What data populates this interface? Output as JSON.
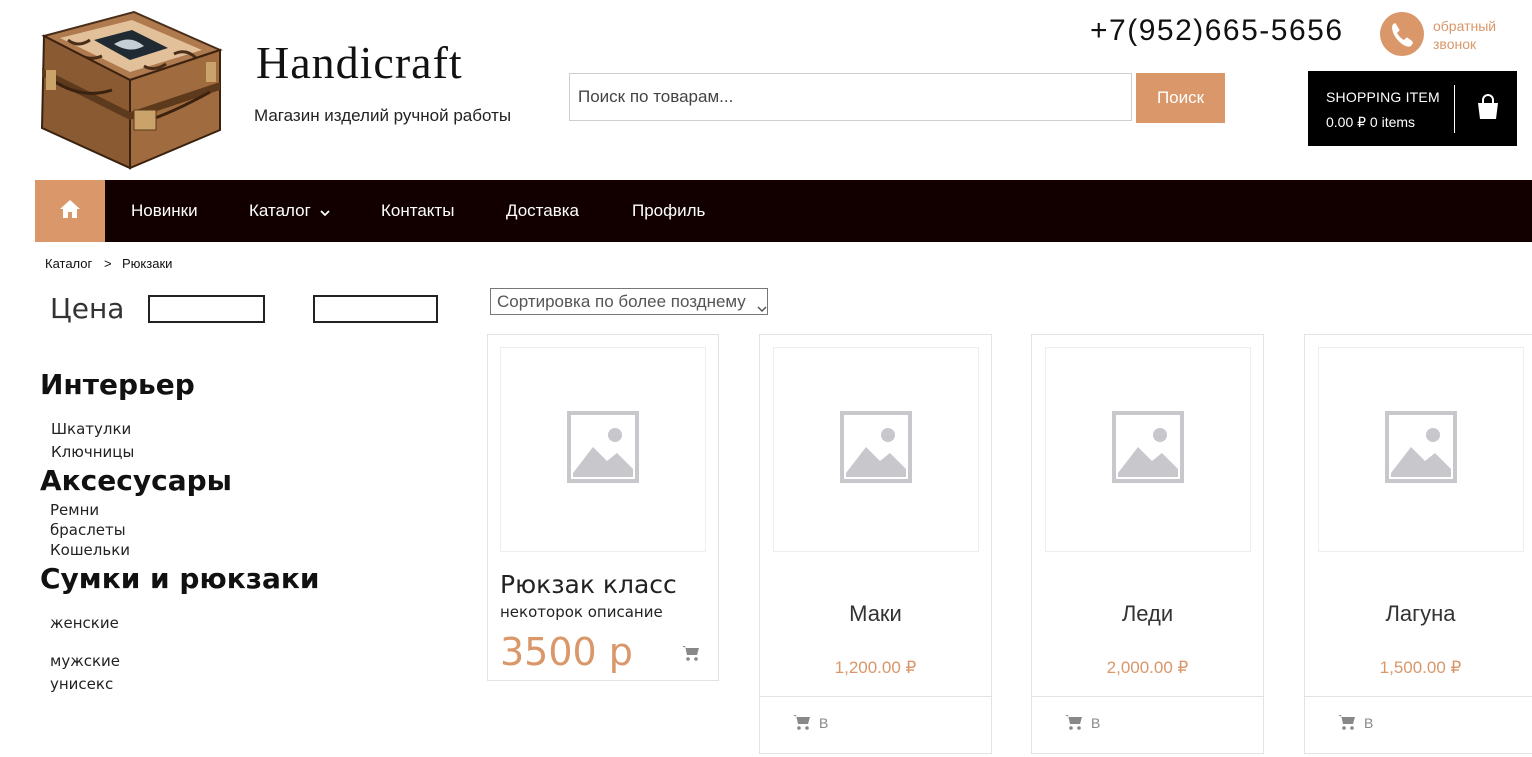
{
  "header": {
    "site_title": "Handicraft",
    "tagline": "Магазин изделий ручной работы",
    "phone": "+7(952)665-5656",
    "callback_line1": "обратный",
    "callback_line2": "звонок"
  },
  "search": {
    "placeholder": "Поиск по товарам...",
    "button_label": "Поиск"
  },
  "cart": {
    "title": "SHOPPING ITEM",
    "summary": "0.00 ₽ 0 items"
  },
  "nav": {
    "items": [
      "Новинки",
      "Каталог",
      "Контакты",
      "Доставка",
      "Профиль"
    ]
  },
  "breadcrumb": {
    "items": [
      "Каталог",
      ">",
      "Рюкзаки"
    ]
  },
  "filter": {
    "price_label": "Цена"
  },
  "categories": [
    {
      "title": "Интерьер",
      "items": [
        "Шкатулки",
        "Ключницы"
      ]
    },
    {
      "title": "Аксесусары",
      "items": [
        "Ремни",
        "браслеты",
        "Кошельки"
      ]
    },
    {
      "title": "Сумки и рюкзаки",
      "items": [
        "женские",
        "мужские",
        "унисекс"
      ]
    }
  ],
  "sort": {
    "selected": "Сортировка по более позднему"
  },
  "featured_product": {
    "name": "Рюкзак класс",
    "description": "некоторок описание",
    "price": "3500 р"
  },
  "products": [
    {
      "name": "Маки",
      "price": "1,200.00 ₽",
      "cart_label": "В"
    },
    {
      "name": "Леди",
      "price": "2,000.00 ₽",
      "cart_label": "В"
    },
    {
      "name": "Лагуна",
      "price": "1,500.00 ₽",
      "cart_label": "В"
    }
  ],
  "colors": {
    "accent": "#d9976a",
    "nav_bg": "#120000",
    "cart_bg": "#000000"
  },
  "icons": [
    "home-icon",
    "chevron-down-icon",
    "phone-icon",
    "shopping-bag-icon",
    "image-placeholder-icon",
    "cart-icon"
  ]
}
